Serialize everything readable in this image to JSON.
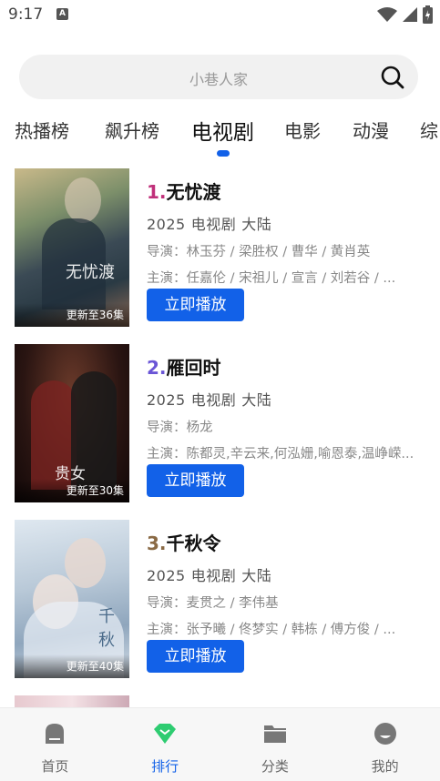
{
  "status_bar": {
    "time": "9:17",
    "notification_letter": "A"
  },
  "search": {
    "placeholder": "小巷人家"
  },
  "tabs": [
    {
      "label": "热播榜"
    },
    {
      "label": "飙升榜"
    },
    {
      "label": "电视剧",
      "active": true
    },
    {
      "label": "电影"
    },
    {
      "label": "动漫"
    },
    {
      "label": "综"
    }
  ],
  "items": [
    {
      "rank": "1.",
      "rank_color": "#c0307a",
      "name": "无忧渡",
      "year": "2025",
      "category": "电视剧",
      "region": "大陆",
      "director": "导演：林玉芬 / 梁胜权 / 曹华 / 黄肖英",
      "cast": "主演：任嘉伦 / 宋祖儿 / 宣言 / 刘若谷 / ...",
      "badge": "更新至36集",
      "button": "立即播放",
      "poster_title": "无忧渡"
    },
    {
      "rank": "2.",
      "rank_color": "#6a55d6",
      "name": "雁回时",
      "year": "2025",
      "category": "电视剧",
      "region": "大陆",
      "director": "导演：杨龙",
      "cast": "主演：陈都灵,辛云来,何泓姗,喻恩泰,温峥嵘...",
      "badge": "更新至30集",
      "button": "立即播放",
      "poster_title": "贵女"
    },
    {
      "rank": "3.",
      "rank_color": "#8a6a45",
      "name": "千秋令",
      "year": "2025",
      "category": "电视剧",
      "region": "大陆",
      "director": "导演：麦贯之 / 李伟基",
      "cast": "主演：张予曦 / 佟梦实 / 韩栋 / 傅方俊 / ...",
      "badge": "更新至40集",
      "button": "立即播放",
      "poster_title": "千秋"
    }
  ],
  "nav": [
    {
      "label": "首页",
      "icon": "home-icon"
    },
    {
      "label": "排行",
      "icon": "ranking-diamond-icon",
      "active": true
    },
    {
      "label": "分类",
      "icon": "folder-icon"
    },
    {
      "label": "我的",
      "icon": "profile-icon"
    }
  ],
  "colors": {
    "accent": "#1261e8",
    "nav_active": "#2ecc71"
  }
}
